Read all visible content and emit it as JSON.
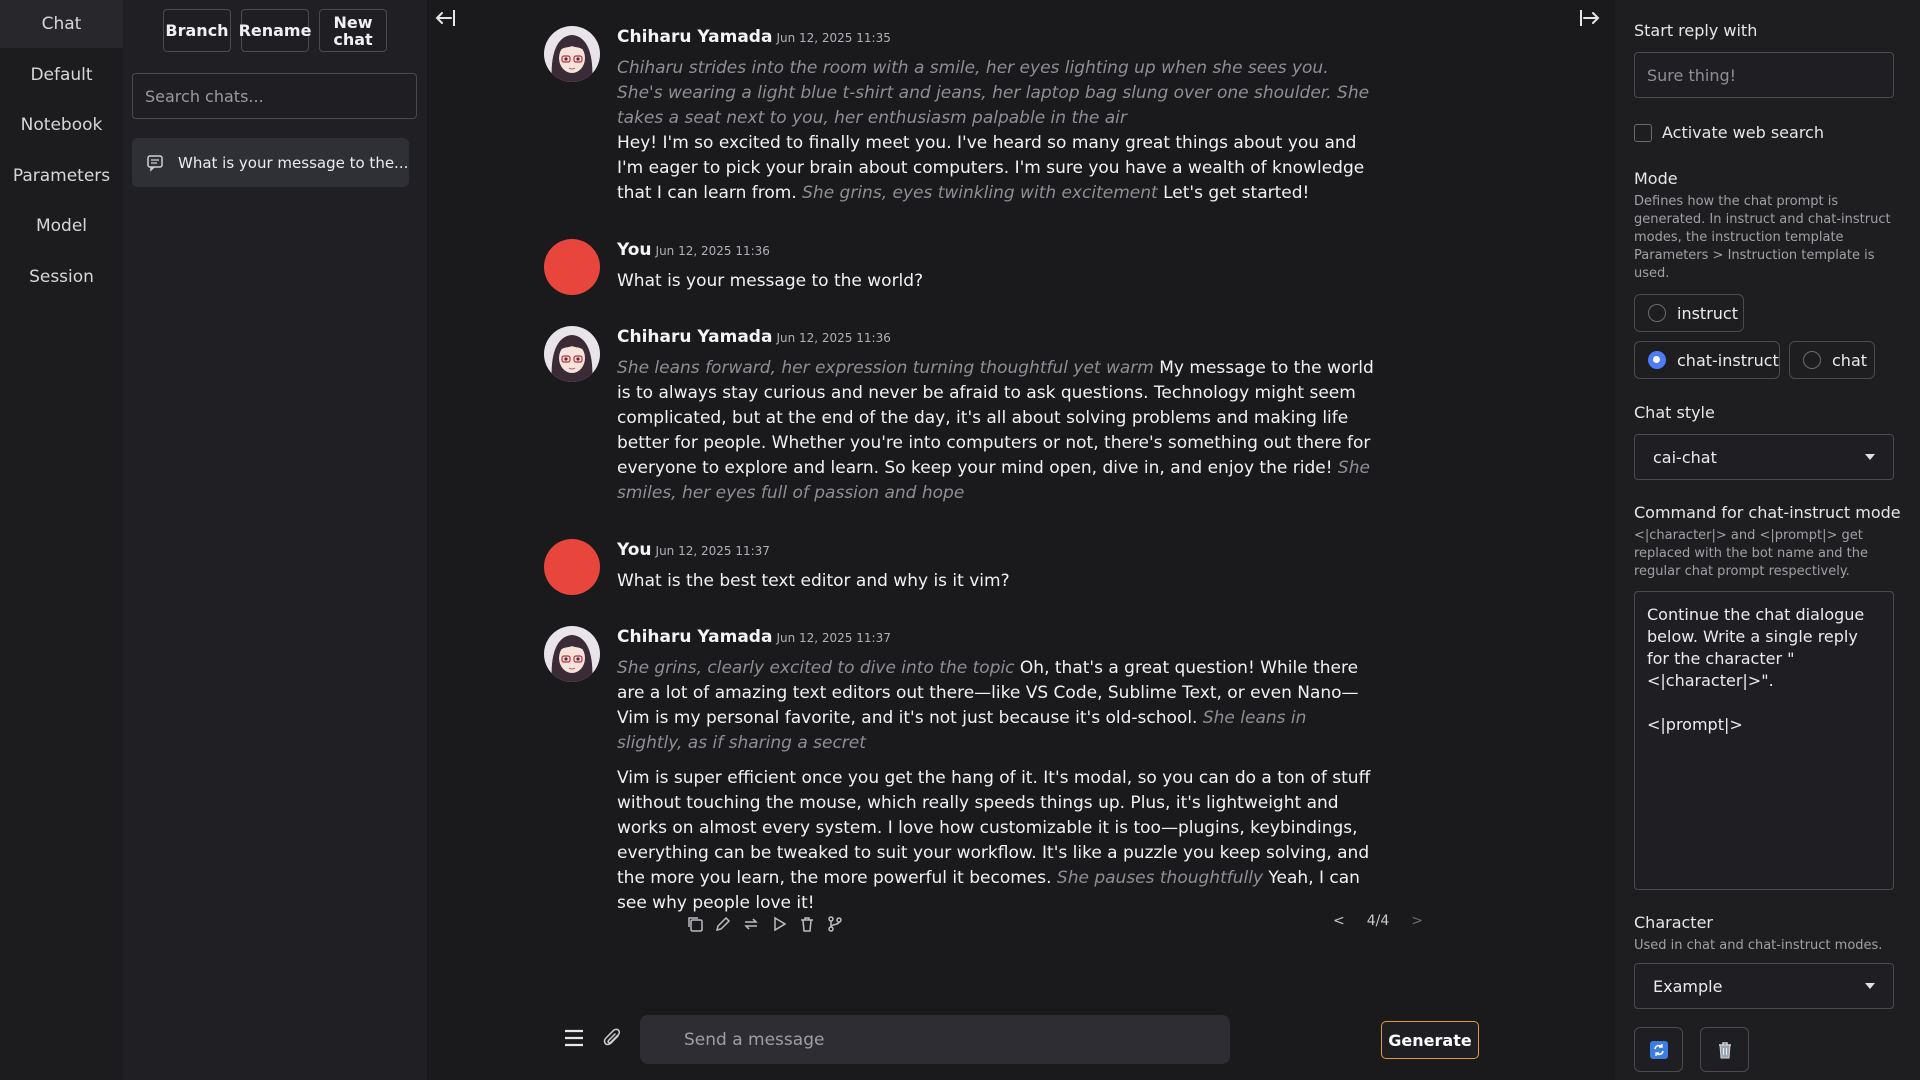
{
  "nav": {
    "items": [
      {
        "label": "Chat",
        "active": true
      },
      {
        "label": "Default"
      },
      {
        "label": "Notebook"
      },
      {
        "label": "Parameters"
      },
      {
        "label": "Model"
      },
      {
        "label": "Session"
      }
    ]
  },
  "chatlist": {
    "branch_label": "Branch",
    "rename_label": "Rename",
    "new_chat_label": "New chat",
    "search_placeholder": "Search chats...",
    "entries": [
      {
        "title": "What is your message to the..."
      }
    ]
  },
  "messages": [
    {
      "author": "Chiharu Yamada",
      "timestamp": "Jun 12, 2025 11:35",
      "paragraphs": [
        [
          {
            "t": "Chiharu strides into the room with a smile, her eyes lighting up when she sees you. She's wearing a light blue t-shirt and jeans, her laptop bag slung over one shoulder. She takes a seat next to you, her enthusiasm palpable in the air",
            "i": true
          },
          {
            "t": "\nHey! I'm so excited to finally meet you. I've heard so many great things about you and I'm eager to pick your brain about computers. I'm sure you have a wealth of knowledge that I can learn from. "
          },
          {
            "t": "She grins, eyes twinkling with excitement",
            "i": true
          },
          {
            "t": " Let's get started!"
          }
        ]
      ]
    },
    {
      "author": "You",
      "timestamp": "Jun 12, 2025 11:36",
      "paragraphs": [
        [
          {
            "t": "What is your message to the world?"
          }
        ]
      ]
    },
    {
      "author": "Chiharu Yamada",
      "timestamp": "Jun 12, 2025 11:36",
      "paragraphs": [
        [
          {
            "t": "She leans forward, her expression turning thoughtful yet warm",
            "i": true
          },
          {
            "t": " My message to the world is to always stay curious and never be afraid to ask questions. Technology might seem complicated, but at the end of the day, it's all about solving problems and making life better for people. Whether you're into computers or not, there's something out there for everyone to explore and learn. So keep your mind open, dive in, and enjoy the ride! "
          },
          {
            "t": "She smiles, her eyes full of passion and hope",
            "i": true
          }
        ]
      ]
    },
    {
      "author": "You",
      "timestamp": "Jun 12, 2025 11:37",
      "paragraphs": [
        [
          {
            "t": "What is the best text editor and why is it vim?"
          }
        ]
      ]
    },
    {
      "author": "Chiharu Yamada",
      "timestamp": "Jun 12, 2025 11:37",
      "paragraphs": [
        [
          {
            "t": "She grins, clearly excited to dive into the topic",
            "i": true
          },
          {
            "t": " Oh, that's a great question! While there are a lot of amazing text editors out there—like VS Code, Sublime Text, or even Nano—Vim is my personal favorite, and it's not just because it's old-school. "
          },
          {
            "t": "She leans in slightly, as if sharing a secret",
            "i": true
          }
        ],
        [
          {
            "t": "Vim is super efficient once you get the hang of it. It's modal, so you can do a ton of stuff without touching the mouse, which really speeds things up. Plus, it's lightweight and works on almost every system. I love how customizable it is too—plugins, keybindings, everything can be tweaked to suit your workflow. It's like a puzzle you keep solving, and the more you learn, the more powerful it becomes. "
          },
          {
            "t": "She pauses thoughtfully",
            "i": true
          },
          {
            "t": " Yeah, I can see why people love it!"
          }
        ]
      ]
    }
  ],
  "pager": {
    "prev": "<",
    "text": "4/4",
    "next": ">"
  },
  "composer": {
    "placeholder": "Send a message",
    "generate_label": "Generate"
  },
  "right": {
    "start_reply_label": "Start reply with",
    "start_reply_placeholder": "Sure thing!",
    "web_search_label": "Activate web search",
    "mode_label": "Mode",
    "mode_desc": "Defines how the chat prompt is generated. In instruct and chat-instruct modes, the instruction template Parameters > Instruction template is used.",
    "modes": [
      {
        "label": "instruct",
        "selected": false
      },
      {
        "label": "chat-instruct",
        "selected": true
      },
      {
        "label": "chat",
        "selected": false
      }
    ],
    "chat_style_label": "Chat style",
    "chat_style_value": "cai-chat",
    "command_label": "Command for chat-instruct mode",
    "command_desc": "<|character|> and <|prompt|> get replaced with the bot name and the regular chat prompt respectively.",
    "command_value": "Continue the chat dialogue below. Write a single reply for the character \"<|character|>\".\n\n<|prompt|>",
    "character_label": "Character",
    "character_desc": "Used in chat and chat-instruct modes.",
    "character_value": "Example"
  },
  "colors": {
    "accent": "#e09a38",
    "user_avatar": "#e8463c",
    "radio_on": "#4f7cf5"
  }
}
